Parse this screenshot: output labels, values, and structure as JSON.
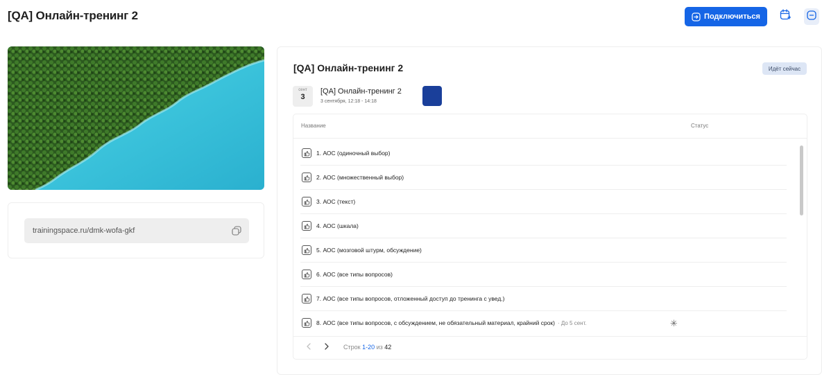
{
  "header": {
    "title": "[QA] Онлайн-тренинг 2",
    "connect_label": "Подключиться"
  },
  "link": {
    "url": "trainingspace.ru/dmk-wofa-gkf"
  },
  "card": {
    "title": "[QA] Онлайн-тренинг 2",
    "status_badge": "Идёт сейчас",
    "event": {
      "month": "сент",
      "day": "3",
      "name": "[QA] Онлайн-тренинг 2",
      "time": "3 сентября, 12:18 - 14:18"
    }
  },
  "table": {
    "columns": [
      "Название",
      "Статус"
    ],
    "rows": [
      {
        "label": "1. АОС (одиночный выбор)",
        "due": "",
        "status": ""
      },
      {
        "label": "2. АОС (множественный выбор)",
        "due": "",
        "status": ""
      },
      {
        "label": "3. АОС (текст)",
        "due": "",
        "status": ""
      },
      {
        "label": "4. АОС (шкала)",
        "due": "",
        "status": ""
      },
      {
        "label": "5. АОС (мозговой штурм, обсуждение)",
        "due": "",
        "status": ""
      },
      {
        "label": "6. АОС (все типы вопросов)",
        "due": "",
        "status": ""
      },
      {
        "label": "7. АОС (все типы вопросов, отложенный доступ до тренинга с увед.)",
        "due": "",
        "status": ""
      },
      {
        "label": "8. АОС (все типы вопросов, с обсуждением, не обязательный материал, крайний срок)",
        "due": "· До 5 сент.",
        "status": "✳"
      }
    ],
    "pagination": {
      "prefix": "Строк",
      "range": "1-20",
      "of": "из",
      "total": "42"
    }
  },
  "colors": {
    "accent": "#1565e6",
    "badge_bg": "#dde6f5",
    "event_thumb": "#1a3f9a"
  },
  "icons": [
    "login-icon",
    "calendar-plus-icon",
    "minus-icon",
    "copy-icon",
    "thumbs-up-icon",
    "chevron-left-icon",
    "chevron-right-icon"
  ]
}
